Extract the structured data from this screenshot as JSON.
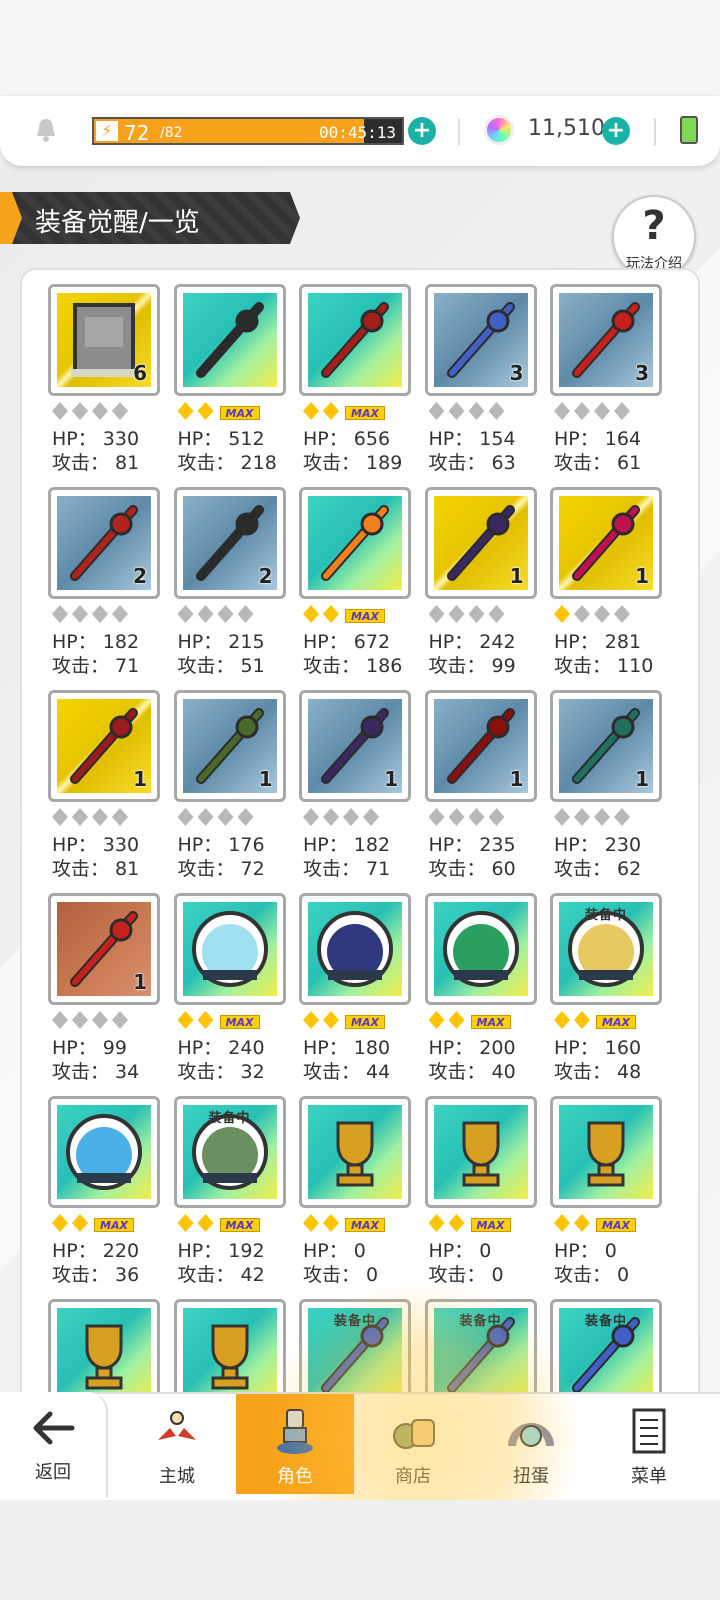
{
  "topbar": {
    "energy_current": "72",
    "energy_max": "/82",
    "energy_fraction": 0.878,
    "energy_timer": "00:45:13",
    "gems": "11,510"
  },
  "header": {
    "title": "装备觉醒/一览",
    "help_label": "玩法介绍"
  },
  "labels": {
    "hp": "HP：",
    "atk": "攻击：",
    "equipped": "装备中",
    "max": "MAX"
  },
  "items": [
    {
      "name": "stone-tablet",
      "bg": "gold",
      "icon": "stone-tablet-icon",
      "count": "6",
      "stars": 0,
      "max": false,
      "hp": "330",
      "atk": "81",
      "equipped": false
    },
    {
      "name": "orange-pickaxe",
      "bg": "teal",
      "icon": "pickaxe-icon",
      "count": "",
      "stars": 2,
      "max": true,
      "hp": "512",
      "atk": "218",
      "equipped": false
    },
    {
      "name": "red-chest-armor",
      "bg": "teal",
      "icon": "armor-icon",
      "count": "",
      "stars": 2,
      "max": true,
      "hp": "656",
      "atk": "189",
      "equipped": false
    },
    {
      "name": "blue-sword",
      "bg": "blue",
      "icon": "sword-icon",
      "count": "3",
      "stars": 0,
      "max": false,
      "hp": "154",
      "atk": "63",
      "equipped": false
    },
    {
      "name": "red-spear",
      "bg": "blue",
      "icon": "spear-icon",
      "count": "3",
      "stars": 0,
      "max": false,
      "hp": "164",
      "atk": "61",
      "equipped": false
    },
    {
      "name": "red-scythe",
      "bg": "blue",
      "icon": "scythe-icon",
      "count": "2",
      "stars": 0,
      "max": false,
      "hp": "182",
      "atk": "71",
      "equipped": false
    },
    {
      "name": "dark-pickaxe",
      "bg": "blue",
      "icon": "pickaxe-icon",
      "count": "2",
      "stars": 0,
      "max": false,
      "hp": "215",
      "atk": "51",
      "equipped": false
    },
    {
      "name": "fire-mace",
      "bg": "teal",
      "icon": "mace-icon",
      "count": "",
      "stars": 2,
      "max": true,
      "hp": "672",
      "atk": "186",
      "equipped": false
    },
    {
      "name": "purple-axe",
      "bg": "gold",
      "icon": "axe-icon",
      "count": "1",
      "stars": 0,
      "max": false,
      "hp": "242",
      "atk": "99",
      "equipped": false
    },
    {
      "name": "star-staff",
      "bg": "gold",
      "icon": "staff-icon",
      "count": "1",
      "stars": 1,
      "max": false,
      "hp": "281",
      "atk": "110",
      "equipped": false
    },
    {
      "name": "red-bow",
      "bg": "gold",
      "icon": "bow-icon",
      "count": "1",
      "stars": 0,
      "max": false,
      "hp": "330",
      "atk": "81",
      "equipped": false
    },
    {
      "name": "green-halberd",
      "bg": "blue",
      "icon": "halberd-icon",
      "count": "1",
      "stars": 0,
      "max": false,
      "hp": "176",
      "atk": "72",
      "equipped": false
    },
    {
      "name": "red-axe",
      "bg": "blue",
      "icon": "axe-icon",
      "count": "1",
      "stars": 0,
      "max": false,
      "hp": "182",
      "atk": "71",
      "equipped": false
    },
    {
      "name": "red-boomerang",
      "bg": "blue",
      "icon": "boomerang-icon",
      "count": "1",
      "stars": 0,
      "max": false,
      "hp": "235",
      "atk": "60",
      "equipped": false
    },
    {
      "name": "green-gauntlet",
      "bg": "blue",
      "icon": "gauntlet-icon",
      "count": "1",
      "stars": 0,
      "max": false,
      "hp": "230",
      "atk": "62",
      "equipped": false
    },
    {
      "name": "blue-spear",
      "bg": "brown",
      "icon": "spear-icon",
      "count": "1",
      "stars": 0,
      "max": false,
      "hp": "99",
      "atk": "34",
      "equipped": false
    },
    {
      "name": "forest-orb",
      "bg": "teal",
      "icon": "orb-icon",
      "count": "",
      "stars": 2,
      "max": true,
      "hp": "240",
      "atk": "32",
      "equipped": false
    },
    {
      "name": "desert-orb",
      "bg": "teal",
      "icon": "orb-icon",
      "count": "",
      "stars": 2,
      "max": true,
      "hp": "180",
      "atk": "44",
      "equipped": false
    },
    {
      "name": "ship-orb",
      "bg": "teal",
      "icon": "orb-icon",
      "count": "",
      "stars": 2,
      "max": true,
      "hp": "200",
      "atk": "40",
      "equipped": false
    },
    {
      "name": "ruins-orb",
      "bg": "teal",
      "icon": "orb-icon",
      "count": "",
      "stars": 2,
      "max": true,
      "hp": "160",
      "atk": "48",
      "equipped": true
    },
    {
      "name": "ice-orb",
      "bg": "teal",
      "icon": "orb-icon",
      "count": "",
      "stars": 2,
      "max": true,
      "hp": "220",
      "atk": "36",
      "equipped": false
    },
    {
      "name": "night-orb",
      "bg": "teal",
      "icon": "orb-icon",
      "count": "",
      "stars": 2,
      "max": true,
      "hp": "192",
      "atk": "42",
      "equipped": true
    },
    {
      "name": "gold-trophy",
      "bg": "teal",
      "icon": "trophy-icon",
      "count": "",
      "stars": 2,
      "max": true,
      "hp": "0",
      "atk": "0",
      "equipped": false
    },
    {
      "name": "silver-trophy",
      "bg": "teal",
      "icon": "trophy-icon",
      "count": "",
      "stars": 2,
      "max": true,
      "hp": "0",
      "atk": "0",
      "equipped": false
    },
    {
      "name": "bronze-trophy",
      "bg": "teal",
      "icon": "trophy-icon",
      "count": "",
      "stars": 2,
      "max": true,
      "hp": "0",
      "atk": "0",
      "equipped": false
    },
    {
      "name": "pink-trophy",
      "bg": "teal",
      "icon": "trophy-icon",
      "count": "",
      "stars": 0,
      "max": false,
      "hp": "",
      "atk": "",
      "equipped": false
    },
    {
      "name": "teal-trophy",
      "bg": "teal",
      "icon": "trophy-icon",
      "count": "",
      "stars": 0,
      "max": false,
      "hp": "",
      "atk": "",
      "equipped": false
    },
    {
      "name": "purple-sword",
      "bg": "teal",
      "icon": "sword-icon",
      "count": "",
      "stars": 0,
      "max": false,
      "hp": "",
      "atk": "",
      "equipped": true
    },
    {
      "name": "rainbow-sword",
      "bg": "teal",
      "icon": "sword-icon",
      "count": "",
      "stars": 0,
      "max": false,
      "hp": "",
      "atk": "",
      "equipped": true
    },
    {
      "name": "blue-gold-sword",
      "bg": "teal",
      "icon": "sword-icon",
      "count": "",
      "stars": 0,
      "max": false,
      "hp": "",
      "atk": "",
      "equipped": true
    }
  ],
  "nav": {
    "back": "返回",
    "items": [
      {
        "key": "town",
        "label": "主城",
        "icon": "town-icon"
      },
      {
        "key": "character",
        "label": "角色",
        "icon": "character-icon",
        "active": true
      },
      {
        "key": "shop",
        "label": "商店",
        "icon": "shop-icon"
      },
      {
        "key": "gacha",
        "label": "扭蛋",
        "icon": "gacha-icon"
      },
      {
        "key": "menu",
        "label": "菜单",
        "icon": "menu-icon"
      }
    ]
  },
  "colors": {
    "accent": "#f8a11b",
    "teal": "#1ab2a6",
    "panel_bg": "#ffffff"
  }
}
